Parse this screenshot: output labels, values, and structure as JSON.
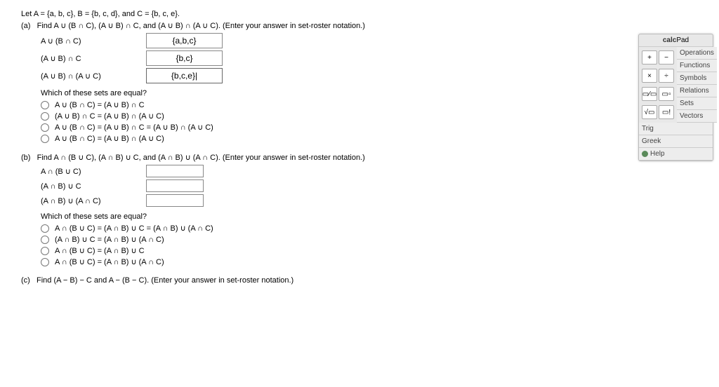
{
  "given": "Let A = {a, b, c}, B = {b, c, d}, and C = {b, c, e}.",
  "partA": {
    "marker": "(a)",
    "prompt": "Find A ∪ (B ∩ C), (A ∪ B) ∩ C, and (A ∪ B) ∩ (A ∪ C). (Enter your answer in set-roster notation.)",
    "rows": [
      {
        "label": "A ∪ (B ∩ C)",
        "value": "{a,b,c}"
      },
      {
        "label": "(A ∪ B) ∩ C",
        "value": "{b,c}"
      },
      {
        "label": "(A ∪ B) ∩ (A ∪ C)",
        "value": "{b,c,e}|"
      }
    ],
    "equalQ": "Which of these sets are equal?",
    "options": [
      "A ∪ (B ∩ C) = (A ∪ B) ∩ C",
      "(A ∪ B) ∩ C = (A ∪ B) ∩ (A ∪ C)",
      "A ∪ (B ∩ C) = (A ∪ B) ∩ C = (A ∪ B) ∩ (A ∪ C)",
      "A ∪ (B ∩ C) = (A ∪ B) ∩ (A ∪ C)"
    ]
  },
  "partB": {
    "marker": "(b)",
    "prompt": "Find A ∩ (B ∪ C), (A ∩ B) ∪ C, and (A ∩ B) ∪ (A ∩ C). (Enter your answer in set-roster notation.)",
    "rows": [
      {
        "label": "A ∩ (B ∪ C)"
      },
      {
        "label": "(A ∩ B) ∪ C"
      },
      {
        "label": "(A ∩ B) ∪ (A ∩ C)"
      }
    ],
    "equalQ": "Which of these sets are equal?",
    "options": [
      "A ∩ (B ∪ C) = (A ∩ B) ∪ C = (A ∩ B) ∪ (A ∩ C)",
      "(A ∩ B) ∪ C = (A ∩ B) ∪ (A ∩ C)",
      "A ∩ (B ∪ C) = (A ∩ B) ∪ C",
      "A ∩ (B ∪ C) = (A ∩ B) ∪ (A ∩ C)"
    ]
  },
  "partC": {
    "marker": "(c)",
    "prompt": "Find (A − B) − C and A − (B − C). (Enter your answer in set-roster notation.)"
  },
  "calcpad": {
    "title_bold": "calc",
    "title_light": "Pad",
    "btns": {
      "plus": "+",
      "minus": "−",
      "times": "×",
      "div": "÷",
      "frac": "▭⁄▭",
      "exp": "▭▫",
      "sqrt": "√▭",
      "fact": "▭!"
    },
    "cats": [
      "Operations",
      "Functions",
      "Symbols",
      "Relations",
      "Sets",
      "Vectors",
      "Trig",
      "Greek",
      "Help"
    ]
  }
}
